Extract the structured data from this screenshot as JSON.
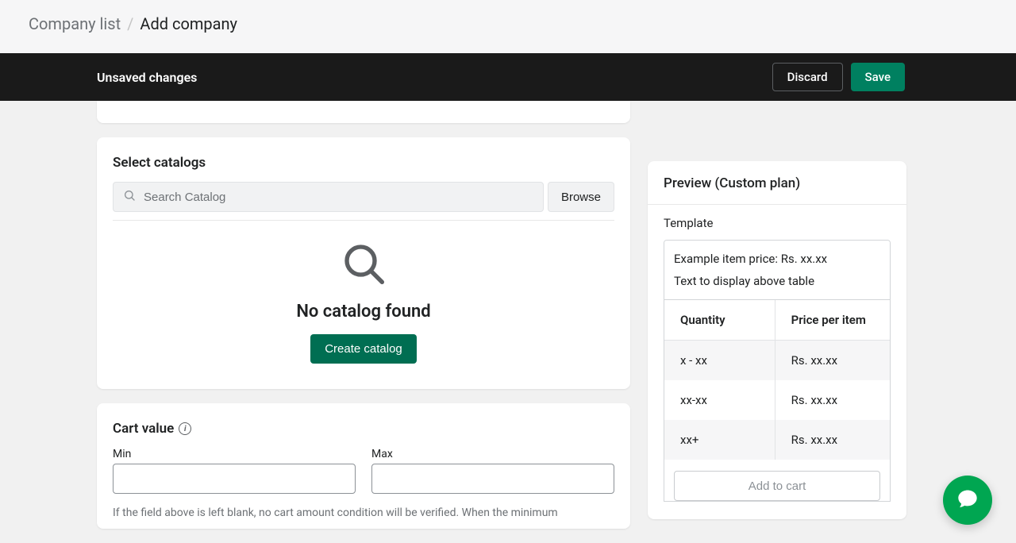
{
  "breadcrumb": {
    "parent": "Company list",
    "current": "Add company"
  },
  "unsaved_bar": {
    "label": "Unsaved changes",
    "discard": "Discard",
    "save": "Save"
  },
  "catalogs": {
    "title": "Select catalogs",
    "search_placeholder": "Search Catalog",
    "browse": "Browse",
    "empty_title": "No catalog found",
    "create": "Create catalog"
  },
  "cart": {
    "title": "Cart value",
    "min_label": "Min",
    "max_label": "Max",
    "helper": "If the field above is left blank, no cart amount condition will be verified. When the minimum"
  },
  "preview": {
    "title": "Preview (Custom plan)",
    "subtitle": "Template",
    "example_price": "Example item price: Rs. xx.xx",
    "above_table": "Text to display above table",
    "th_qty": "Quantity",
    "th_price": "Price per item",
    "rows": [
      {
        "qty": "x - xx",
        "price": "Rs. xx.xx"
      },
      {
        "qty": "xx-xx",
        "price": "Rs. xx.xx"
      },
      {
        "qty": "xx+",
        "price": "Rs. xx.xx"
      }
    ],
    "add_to_cart": "Add to cart"
  }
}
